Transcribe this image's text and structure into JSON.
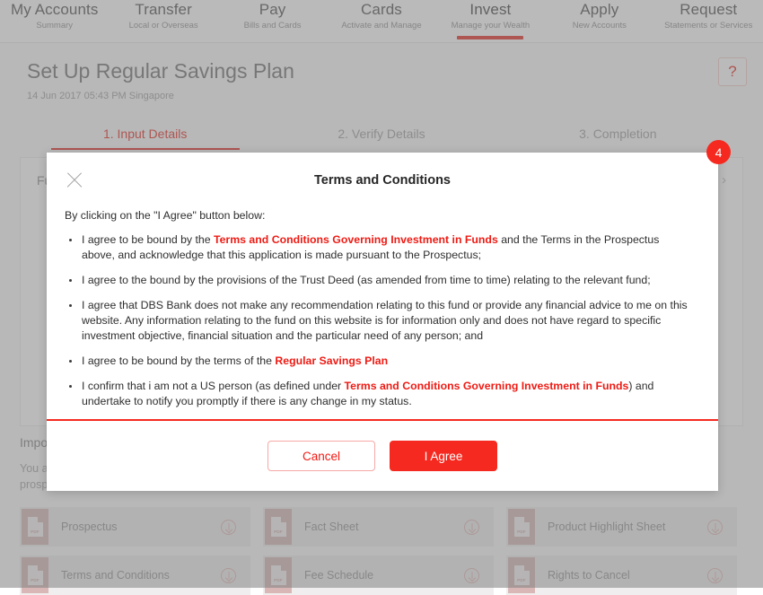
{
  "nav": {
    "items": [
      {
        "title": "My Accounts",
        "sub": "Summary",
        "active": false
      },
      {
        "title": "Transfer",
        "sub": "Local or Overseas",
        "active": false
      },
      {
        "title": "Pay",
        "sub": "Bills and Cards",
        "active": false
      },
      {
        "title": "Cards",
        "sub": "Activate and Manage",
        "active": false
      },
      {
        "title": "Invest",
        "sub": "Manage your Wealth",
        "active": true
      },
      {
        "title": "Apply",
        "sub": "New Accounts",
        "active": false
      },
      {
        "title": "Request",
        "sub": "Statements or Services",
        "active": false
      }
    ]
  },
  "page": {
    "title": "Set Up Regular Savings Plan",
    "timestamp": "14 Jun 2017 05:43 PM Singapore",
    "help_label": "?",
    "steps": [
      {
        "label": "1. Input Details",
        "active": true
      },
      {
        "label": "2. Verify Details",
        "active": false
      },
      {
        "label": "3. Completion",
        "active": false
      }
    ],
    "card": {
      "section_label": "Fund Details",
      "chevron": "›"
    },
    "notes": {
      "title": "Important Notes",
      "text": "You are advised to read the prospectus carefully before submitting your application to apply for any units. You may also obtain a copy of the prospectus directly from the fund manager, or subject to availability from any DBS/POSB Branch.",
      "pdf_badge": "PDF",
      "documents": [
        "Prospectus",
        "Fact Sheet",
        "Product Highlight Sheet",
        "Terms and Conditions",
        "Fee Schedule",
        "Rights to Cancel"
      ]
    }
  },
  "modal": {
    "title": "Terms and Conditions",
    "badge": "4",
    "close_label": "close",
    "intro": "By clicking on the \"I Agree\" button below:",
    "terms": [
      {
        "parts": [
          {
            "text": "I agree to be bound by the ",
            "link": false
          },
          {
            "text": "Terms and Conditions Governing Investment in Funds",
            "link": true
          },
          {
            "text": " and the Terms in the Prospectus above, and acknowledge that this application is made pursuant to the Prospectus;",
            "link": false
          }
        ]
      },
      {
        "parts": [
          {
            "text": "I agree to the bound by the provisions of the Trust Deed (as amended from time to time) relating to the relevant fund;",
            "link": false
          }
        ]
      },
      {
        "parts": [
          {
            "text": "I agree that DBS Bank does not make any recommendation relating to this fund or provide any financial advice to me on this website. Any information relating to the fund on this website is for information only and does not have regard to specific investment objective, financial situation and the particular need of any person; and",
            "link": false
          }
        ]
      },
      {
        "parts": [
          {
            "text": "I agree to be bound by the terms of the ",
            "link": false
          },
          {
            "text": "Regular Savings Plan",
            "link": true
          }
        ]
      },
      {
        "parts": [
          {
            "text": "I confirm that i am not a US person (as defined under ",
            "link": false
          },
          {
            "text": "Terms and Conditions Governing Investment in Funds",
            "link": true
          },
          {
            "text": ") and undertake to notify you promptly if there is any change in my status.",
            "link": false
          }
        ]
      }
    ],
    "cancel_label": "Cancel",
    "agree_label": "I Agree"
  },
  "colors": {
    "accent_red": "#f5291f",
    "link_red": "#ee1b14",
    "badge_red": "#f5291f",
    "overlay": "rgba(130,130,130,0.55)"
  }
}
